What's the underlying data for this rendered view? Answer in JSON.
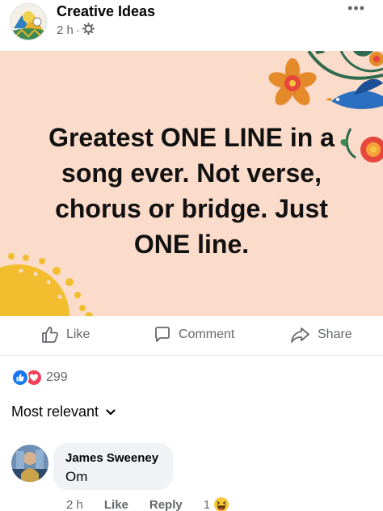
{
  "post": {
    "page_name": "Creative Ideas",
    "time": "2 h",
    "separator": "·",
    "privacy_icon": "gear-icon",
    "more_icon": "ellipsis-icon",
    "more_label": "•••",
    "text": "Greatest ONE LINE in a song ever. Not verse, chorus or bridge. Just ONE line.",
    "background_color": "#fbdbc9"
  },
  "actions": {
    "like": "Like",
    "comment": "Comment",
    "share": "Share"
  },
  "reactions": {
    "icons": [
      "like-reaction-icon",
      "love-reaction-icon"
    ],
    "count": "299"
  },
  "comments": {
    "sort_label": "Most relevant",
    "items": [
      {
        "author": "James Sweeney",
        "text": "Om",
        "time": "2 h",
        "like_label": "Like",
        "reply_label": "Reply",
        "reaction_count": "1",
        "reaction_icon": "haha-reaction-icon"
      }
    ]
  },
  "colors": {
    "facebook_blue": "#1877f2",
    "love_red": "#f33e58",
    "secondary_text": "#65676b"
  }
}
